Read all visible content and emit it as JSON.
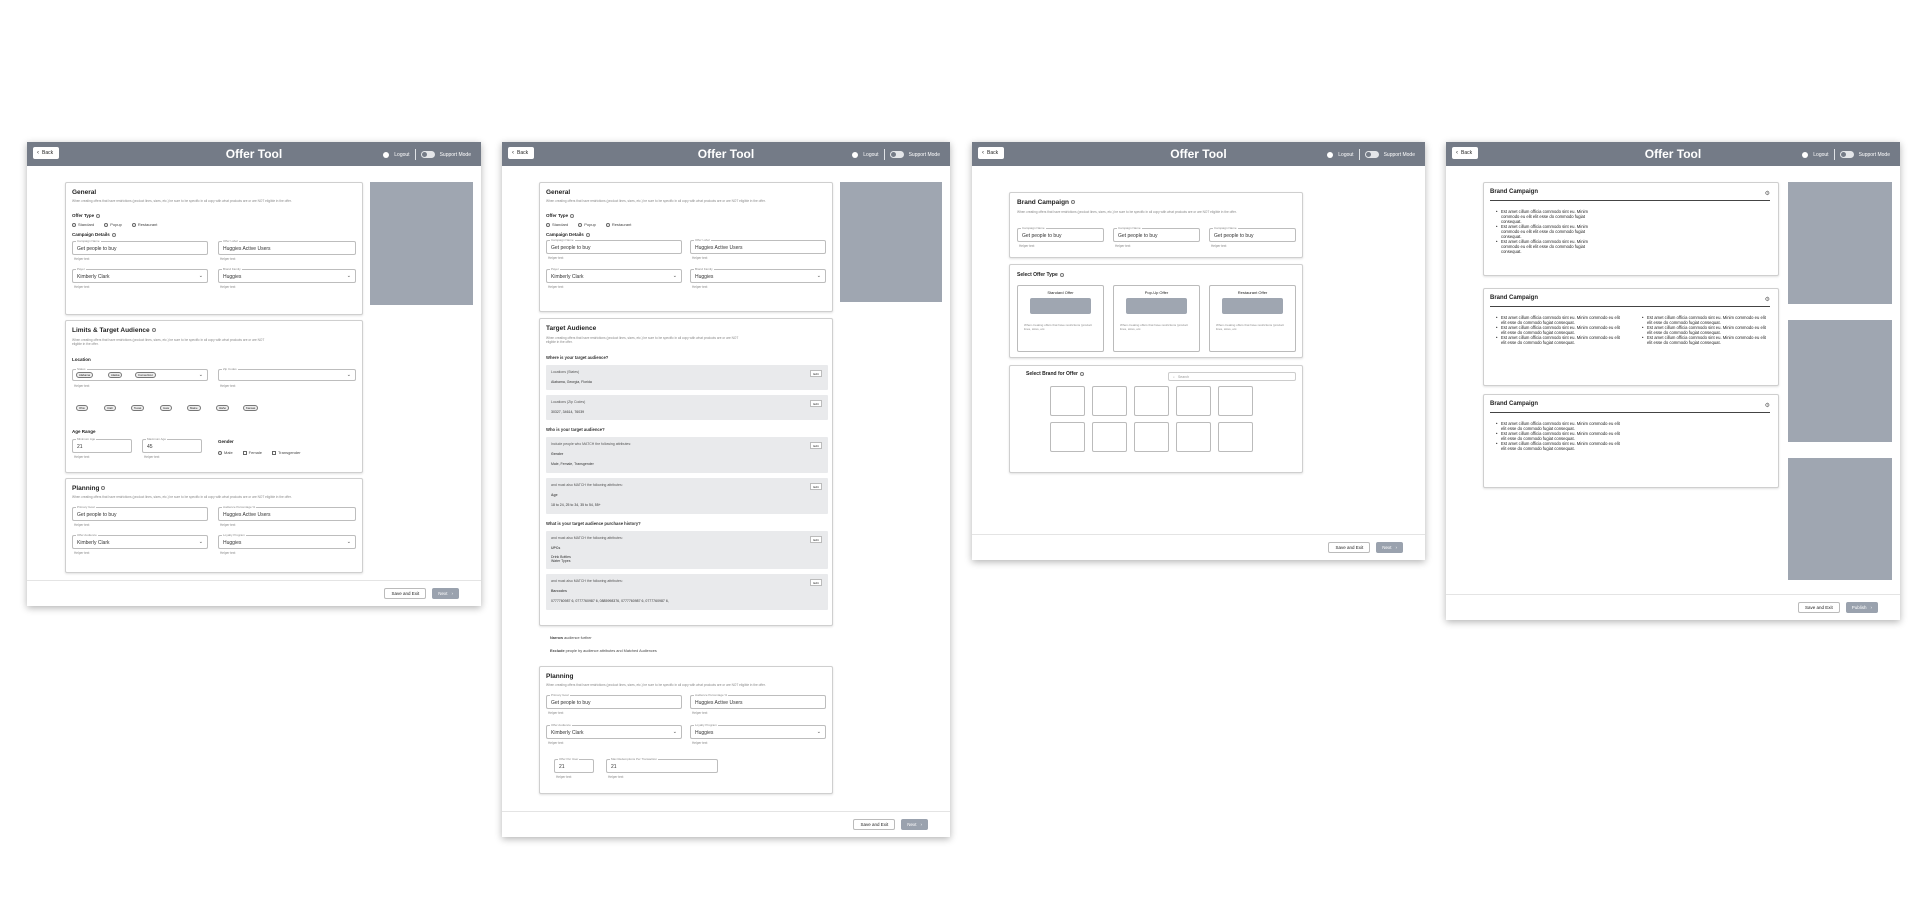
{
  "app_title": "Offer Tool",
  "nav": {
    "back": "Back",
    "logout": "Logout",
    "support_mode": "Support Mode"
  },
  "footer": {
    "save_exit": "Save and Exit",
    "next": "Next",
    "publish": "Publish"
  },
  "common": {
    "helper": "Helper text",
    "desc": "When creating offers that have restrictions (product lines, sizes, etc.) be sure to be specific in all copy with what products are or are NOT eligible in the offer."
  },
  "general": {
    "title": "General",
    "offer_type_label": "Offer Type",
    "offer_types": [
      "Standard",
      "Popup",
      "Restaurant"
    ],
    "campaign_details_label": "Campaign Details",
    "campaign_name_label": "Campaign Name",
    "campaign_name": "Get people to buy",
    "group_label": "Offer Label",
    "group_value": "Huggies Active Users",
    "payer_label": "Payer",
    "payer": "Kimberly Clark",
    "brand_label": "Brand Family",
    "brand": "Huggies"
  },
  "limits": {
    "title": "Limits & Target Audience",
    "location_label": "Location",
    "states_label": "States",
    "chips": [
      "Alabama",
      "Alaska",
      "Connecticut"
    ],
    "zip_label": "Zip Codes",
    "chips2": [
      "Ohio",
      "Utah",
      "Texas",
      "Iowa",
      "Maine",
      "Idaho",
      "Kansas"
    ],
    "age_label": "Age Range",
    "min_age_label": "Minimum Age",
    "min_age": "21",
    "max_age_label": "Maximum Age",
    "max_age": "45",
    "gender_label": "Gender",
    "genders": [
      "Male",
      "Female",
      "Transgender"
    ]
  },
  "planning": {
    "title": "Planning",
    "primary_goal_label": "Primary Goal",
    "primary_goal": "Get people to buy",
    "audience_label": "Audience Percentage %",
    "audience": "Huggies Active Users",
    "offer_audience_label": "Offer Audience",
    "offer_audience": "Kimberly Clark",
    "loyalty_label": "Loyalty Program",
    "loyalty": "Huggies",
    "offer_per_user_label": "Offer Per User",
    "offer_per_user": "21",
    "max_redeem_label": "Max Redemptions Per Transaction",
    "max_redeem": "21"
  },
  "target": {
    "title": "Target Audience",
    "q1": "Where is your target audience?",
    "loc_states_label": "Locations (States)",
    "loc_states": "Alabama, Georgia, Florida",
    "loc_zip_label": "Locations (Zip Codes)",
    "loc_zip": "30327, 34614, 76039",
    "q2": "Who is your target audience?",
    "include_label": "Include people who MATCH the following attributes:",
    "gender_label": "Gender",
    "genders": "Male, Female, Transgender",
    "and_label": "and must also MATCH the following attributes:",
    "age_label": "Age",
    "ages": "18 to 24, 25 to 34, 35 to 54, 55+",
    "q3": "What is your target audience purchase history?",
    "upc_title": "UPCs",
    "upc_list": "Drink Bottles\nWater Types",
    "barcodes_label": "Barcodes",
    "barcodes": "0777760987 6, 0777760987 6, 0885998376, 0777760987 6, 0777760987 6,",
    "edit": "Edit",
    "narrow": "Narrow",
    "narrow_text": "audience further",
    "exclude": "Exclude",
    "exclude_text": "people by audience attributes and Matched Audiences"
  },
  "brand_campaign": {
    "title": "Brand Campaign",
    "fields": [
      {
        "label": "Campaign Name",
        "value": "Get people to buy"
      },
      {
        "label": "Campaign Name",
        "value": "Get people to buy"
      },
      {
        "label": "Campaign Name",
        "value": "Get people to buy"
      }
    ],
    "select_type": "Select Offer Type",
    "offer_types": [
      {
        "title": "Standard Offer",
        "desc": "When creating offers that have restrictions (product lines, sizes, etc."
      },
      {
        "title": "Pop-Up Offer",
        "desc": "When creating offers that have restrictions (product lines, sizes, etc."
      },
      {
        "title": "Restaurant Offer",
        "desc": "When creating offers that have restrictions (product lines, sizes, etc."
      }
    ],
    "select_brand": "Select Brand for Offer",
    "search_placeholder": "Search"
  },
  "review": {
    "card_title": "Brand Campaign",
    "bullet": "Est amet cillum officia commodo sint eu. Minim commodo eu elit elit esse do commodo fugiat consequat.",
    "bullets_a": [
      "Est amet cillum officia commodo sint eu. Minim commodo eu elit elit esse do commodo fugiat consequat.",
      "Est amet cillum officia commodo sint eu. Minim commodo eu elit elit esse do commodo fugiat consequat.",
      "Est amet cillum officia commodo sint eu. Minim commodo eu elit elit esse do commodo fugiat consequat."
    ]
  },
  "colors": {
    "topbar": "#747b87",
    "placeholder_block": "#9fa6b1",
    "panel": "#e9eaec"
  }
}
